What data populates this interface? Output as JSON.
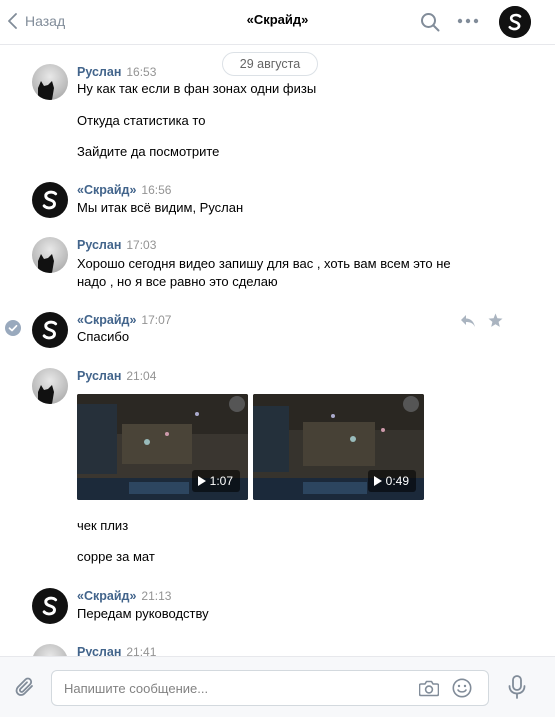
{
  "header": {
    "back_label": "Назад",
    "title": "«Скрайд»"
  },
  "date_divider": "29 августа",
  "groups": [
    {
      "author": "Руслан",
      "time": "16:53",
      "messages": [
        "Ну как так если в фан зонах одни физы",
        "Откуда статистика то",
        "Зайдите да посмотрите"
      ]
    },
    {
      "author": "«Скрайд»",
      "time": "16:56",
      "messages": [
        "Мы итак всё видим, Руслан"
      ]
    },
    {
      "author": "Руслан",
      "time": "17:03",
      "messages": [
        "Хорошо сегодня видео запишу для вас , хоть вам всем это не",
        "надо , но я все равно это сделаю"
      ]
    },
    {
      "author": "«Скрайд»",
      "time": "17:07",
      "messages": [
        "Спасибо"
      ]
    },
    {
      "author": "Руслан",
      "time": "21:04",
      "videos": [
        {
          "duration": "1:07"
        },
        {
          "duration": "0:49"
        }
      ],
      "messages": [
        "чек плиз",
        "сорре за мат"
      ]
    },
    {
      "author": "«Скрайд»",
      "time": "21:13",
      "messages": [
        "Передам руководству"
      ]
    },
    {
      "author": "Руслан",
      "time": "21:41",
      "messages": []
    }
  ],
  "composer": {
    "placeholder": "Напишите сообщение..."
  },
  "colors": {
    "name_link": "#42648b",
    "time_gray": "#939393",
    "icon_gray": "#818c99"
  }
}
